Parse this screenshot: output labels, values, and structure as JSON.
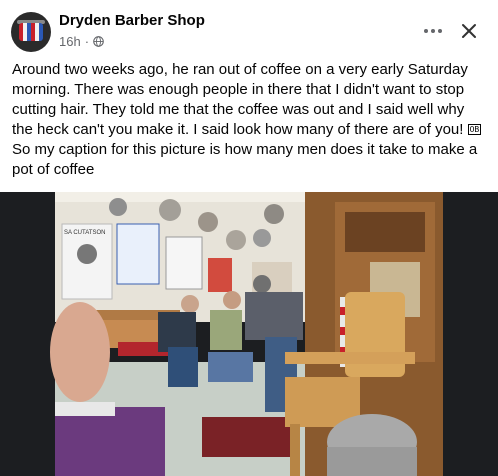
{
  "post": {
    "page_name": "Dryden Barber Shop",
    "timestamp": "16h",
    "separator": "·",
    "audience_icon": "globe-icon",
    "caption_lines": [
      "Around two weeks ago, he ran out of coffee on a very early Saturday",
      "morning. There was enough people in there that I didn't want to stop",
      "cutting hair. They told me that the coffee was out and I said well why",
      "the heck can't you make it. I said look how many of there are of you!",
      "So my caption for this picture is how many men does it take to make a",
      "pot of coffee"
    ],
    "caption_glyph": "OB",
    "photo_signs": {
      "left_poster_header": "SA CUTATSON"
    }
  },
  "colors": {
    "text_primary": "#050505",
    "text_secondary": "#65676b",
    "photo_background": "#1c1e21"
  }
}
